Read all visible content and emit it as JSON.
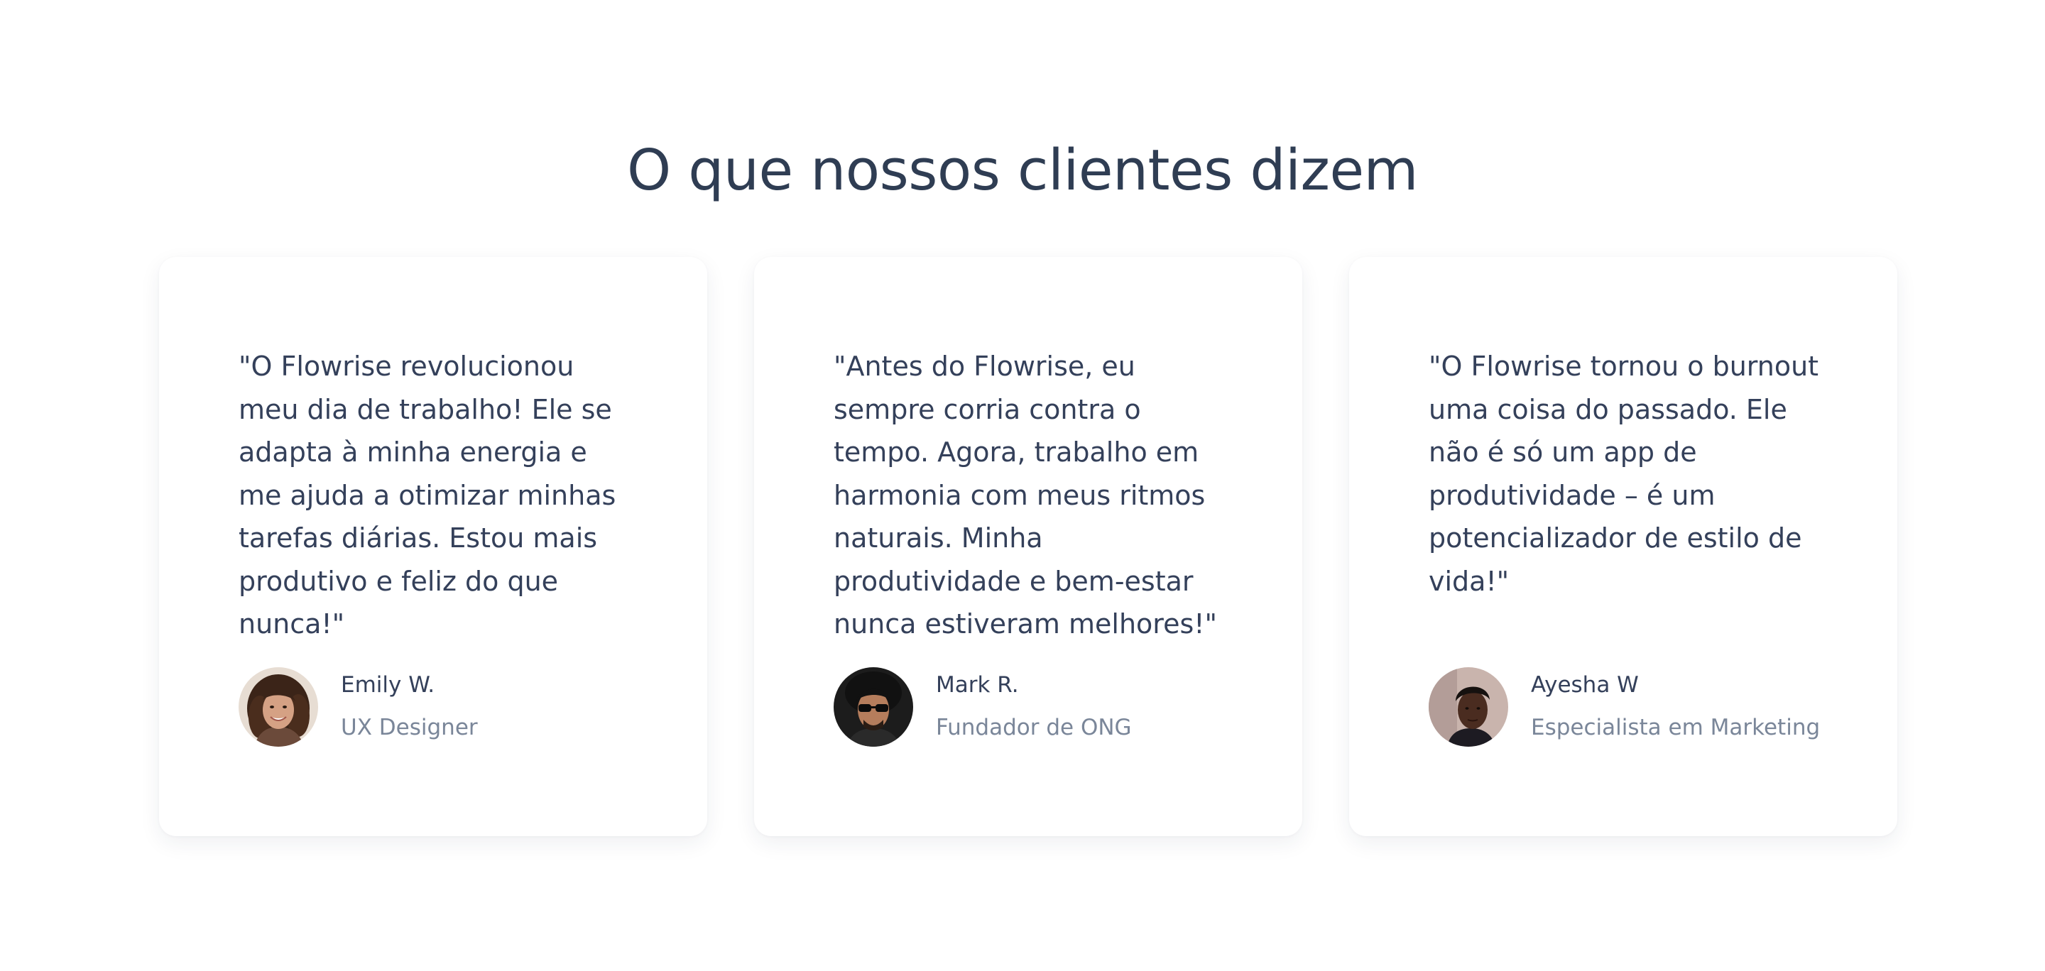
{
  "section": {
    "heading": "O que nossos clientes dizem"
  },
  "testimonials": [
    {
      "quote": "\"O Flowrise revolucionou meu dia de trabalho! Ele se adapta à minha energia e me ajuda a otimizar minhas tarefas diárias. Estou mais produtivo e feliz do que nunca!\"",
      "name": "Emily W.",
      "role": "UX Designer",
      "avatar_icon": "woman-portrait"
    },
    {
      "quote": "\"Antes do Flowrise, eu sempre corria contra o tempo. Agora, trabalho em harmonia com meus ritmos naturais. Minha produtividade e bem-estar nunca estiveram melhores!\"",
      "name": "Mark R.",
      "role": "Fundador de ONG",
      "avatar_icon": "man-sunglasses-portrait"
    },
    {
      "quote": "\"O Flowrise tornou o burnout uma coisa do passado. Ele não é só um app de produtividade – é um potencializador de estilo de vida!\"",
      "name": "Ayesha W",
      "role": "Especialista em Marketing",
      "avatar_icon": "person-portrait"
    }
  ],
  "colors": {
    "heading": "#2f3d53",
    "text": "#34405a",
    "muted": "#7a8699",
    "card": "#ffffff",
    "background": "#ffffff"
  }
}
